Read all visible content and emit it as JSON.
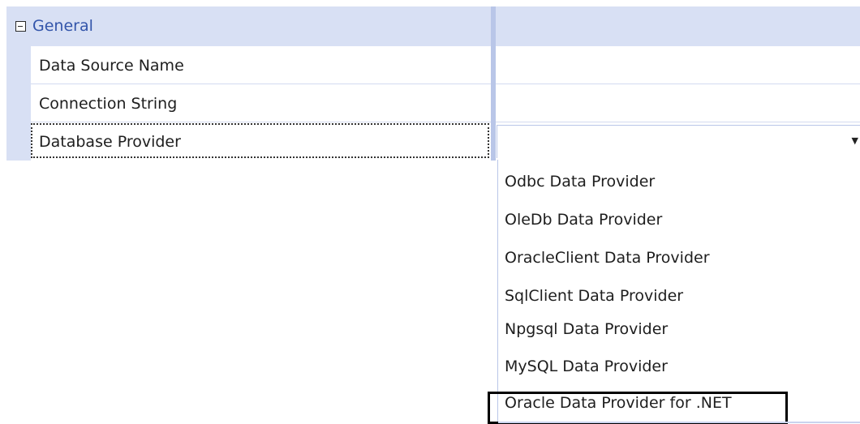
{
  "category": {
    "label": "General",
    "expander": "collapse-icon"
  },
  "properties": [
    {
      "name": "Data Source Name",
      "value": ""
    },
    {
      "name": "Connection String",
      "value": ""
    },
    {
      "name": "Database Provider",
      "value": ""
    }
  ],
  "dropdown": {
    "arrow": "▼",
    "options": [
      "Odbc Data Provider",
      "OleDb Data Provider",
      "OracleClient Data Provider",
      "SqlClient Data Provider",
      "Npgsql Data Provider",
      "MySQL Data Provider",
      "Oracle Data Provider for .NET"
    ],
    "highlighted_index": 6
  },
  "colors": {
    "category_background": "#d8e0f4",
    "category_text": "#3355aa",
    "splitter": "#b9c6e8",
    "highlight_border": "#000000"
  }
}
